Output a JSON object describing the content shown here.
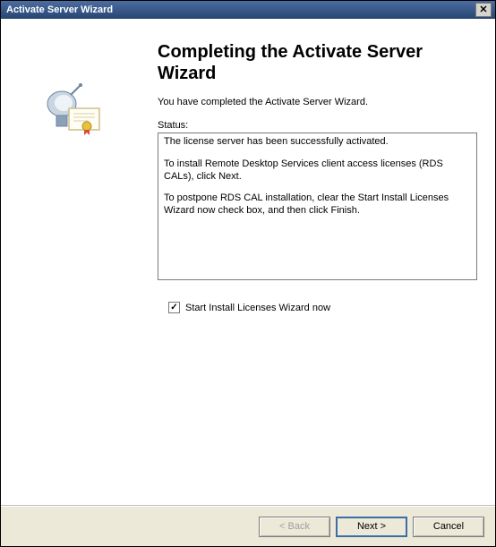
{
  "window": {
    "title": "Activate Server Wizard"
  },
  "main": {
    "heading": "Completing the Activate Server Wizard",
    "intro": "You have completed the Activate Server Wizard.",
    "status_label": "Status:",
    "status_lines": {
      "l1": "The license server has been successfully activated.",
      "l2": "To install Remote Desktop Services client access licenses (RDS CALs), click Next.",
      "l3": "To postpone RDS CAL installation, clear the Start Install Licenses Wizard now check box, and then click Finish."
    },
    "checkbox": {
      "checked": true,
      "label": "Start Install Licenses Wizard now"
    }
  },
  "buttons": {
    "back": "< Back",
    "next": "Next >",
    "cancel": "Cancel"
  }
}
